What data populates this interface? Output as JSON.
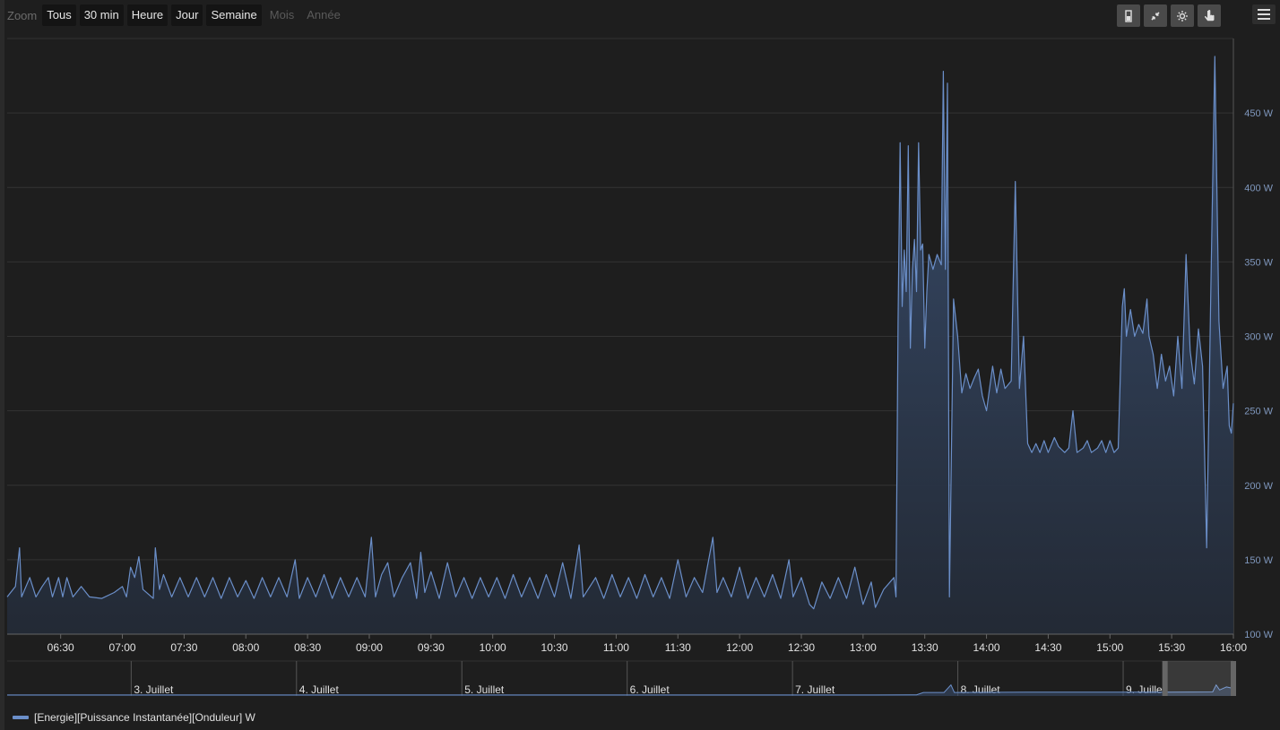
{
  "zoom": {
    "label": "Zoom",
    "buttons": [
      {
        "label": "Tous",
        "enabled": true
      },
      {
        "label": "30 min",
        "enabled": true
      },
      {
        "label": "Heure",
        "enabled": true
      },
      {
        "label": "Jour",
        "enabled": true
      },
      {
        "label": "Semaine",
        "enabled": true
      },
      {
        "label": "Mois",
        "enabled": false
      },
      {
        "label": "Année",
        "enabled": false
      }
    ]
  },
  "toolbar_icons": [
    "column-chart-icon",
    "shrink-arrows-icon",
    "sun-icon",
    "hand-pointer-icon"
  ],
  "menu_icon": "hamburger-menu-icon",
  "colors": {
    "series_line": "#6b8fc9",
    "background": "#1e1e1e",
    "grid": "#333333",
    "axis_label": "#7f97bd"
  },
  "chart_data": {
    "type": "area",
    "title": "",
    "ylim": [
      100,
      500
    ],
    "y_ticks": [
      {
        "value": 100,
        "label": "100 W"
      },
      {
        "value": 150,
        "label": "150 W"
      },
      {
        "value": 200,
        "label": "200 W"
      },
      {
        "value": 250,
        "label": "250 W"
      },
      {
        "value": 300,
        "label": "300 W"
      },
      {
        "value": 350,
        "label": "350 W"
      },
      {
        "value": 400,
        "label": "400 W"
      },
      {
        "value": 450,
        "label": "450 W"
      }
    ],
    "x_range": [
      "06:04",
      "16:00"
    ],
    "x_ticks": [
      "06:30",
      "07:00",
      "07:30",
      "08:00",
      "08:30",
      "09:00",
      "09:30",
      "10:00",
      "10:30",
      "11:00",
      "11:30",
      "12:00",
      "12:30",
      "13:00",
      "13:30",
      "14:00",
      "14:30",
      "15:00",
      "15:30",
      "16:00"
    ],
    "legend_position": "bottom-left",
    "series": [
      {
        "name": "[Energie][Puissance Instantanée][Onduleur] W",
        "x_unit": "time (HH:MM)",
        "points": [
          [
            "06:04",
            125
          ],
          [
            "06:08",
            132
          ],
          [
            "06:10",
            158
          ],
          [
            "06:11",
            125
          ],
          [
            "06:15",
            138
          ],
          [
            "06:18",
            125
          ],
          [
            "06:21",
            132
          ],
          [
            "06:24",
            138
          ],
          [
            "06:26",
            125
          ],
          [
            "06:29",
            138
          ],
          [
            "06:31",
            125
          ],
          [
            "06:33",
            138
          ],
          [
            "06:36",
            125
          ],
          [
            "06:40",
            132
          ],
          [
            "06:44",
            125
          ],
          [
            "06:50",
            124
          ],
          [
            "06:56",
            128
          ],
          [
            "07:00",
            132
          ],
          [
            "07:02",
            125
          ],
          [
            "07:04",
            145
          ],
          [
            "07:06",
            138
          ],
          [
            "07:08",
            152
          ],
          [
            "07:10",
            130
          ],
          [
            "07:15",
            124
          ],
          [
            "07:16",
            158
          ],
          [
            "07:18",
            130
          ],
          [
            "07:20",
            140
          ],
          [
            "07:24",
            125
          ],
          [
            "07:28",
            138
          ],
          [
            "07:32",
            125
          ],
          [
            "07:36",
            138
          ],
          [
            "07:40",
            125
          ],
          [
            "07:44",
            138
          ],
          [
            "07:48",
            124
          ],
          [
            "07:52",
            138
          ],
          [
            "07:56",
            125
          ],
          [
            "08:00",
            136
          ],
          [
            "08:04",
            124
          ],
          [
            "08:08",
            138
          ],
          [
            "08:12",
            125
          ],
          [
            "08:16",
            138
          ],
          [
            "08:20",
            125
          ],
          [
            "08:24",
            150
          ],
          [
            "08:26",
            124
          ],
          [
            "08:30",
            138
          ],
          [
            "08:34",
            125
          ],
          [
            "08:38",
            140
          ],
          [
            "08:42",
            124
          ],
          [
            "08:46",
            138
          ],
          [
            "08:50",
            125
          ],
          [
            "08:54",
            138
          ],
          [
            "08:58",
            125
          ],
          [
            "09:01",
            165
          ],
          [
            "09:03",
            125
          ],
          [
            "09:06",
            140
          ],
          [
            "09:09",
            148
          ],
          [
            "09:12",
            125
          ],
          [
            "09:16",
            138
          ],
          [
            "09:20",
            148
          ],
          [
            "09:23",
            124
          ],
          [
            "09:25",
            155
          ],
          [
            "09:27",
            128
          ],
          [
            "09:30",
            142
          ],
          [
            "09:34",
            124
          ],
          [
            "09:38",
            148
          ],
          [
            "09:42",
            125
          ],
          [
            "09:46",
            138
          ],
          [
            "09:50",
            124
          ],
          [
            "09:54",
            138
          ],
          [
            "09:58",
            125
          ],
          [
            "10:02",
            138
          ],
          [
            "10:06",
            124
          ],
          [
            "10:10",
            140
          ],
          [
            "10:14",
            125
          ],
          [
            "10:18",
            138
          ],
          [
            "10:22",
            124
          ],
          [
            "10:26",
            140
          ],
          [
            "10:30",
            125
          ],
          [
            "10:34",
            148
          ],
          [
            "10:38",
            124
          ],
          [
            "10:42",
            160
          ],
          [
            "10:44",
            125
          ],
          [
            "10:50",
            138
          ],
          [
            "10:54",
            124
          ],
          [
            "10:58",
            140
          ],
          [
            "11:02",
            125
          ],
          [
            "11:06",
            138
          ],
          [
            "11:10",
            124
          ],
          [
            "11:14",
            140
          ],
          [
            "11:18",
            125
          ],
          [
            "11:22",
            138
          ],
          [
            "11:26",
            124
          ],
          [
            "11:30",
            150
          ],
          [
            "11:34",
            125
          ],
          [
            "11:38",
            138
          ],
          [
            "11:42",
            128
          ],
          [
            "11:47",
            165
          ],
          [
            "11:49",
            128
          ],
          [
            "11:52",
            138
          ],
          [
            "11:56",
            125
          ],
          [
            "12:00",
            145
          ],
          [
            "12:04",
            124
          ],
          [
            "12:08",
            138
          ],
          [
            "12:12",
            125
          ],
          [
            "12:16",
            140
          ],
          [
            "12:20",
            124
          ],
          [
            "12:24",
            150
          ],
          [
            "12:26",
            125
          ],
          [
            "12:30",
            138
          ],
          [
            "12:34",
            120
          ],
          [
            "12:36",
            117
          ],
          [
            "12:40",
            135
          ],
          [
            "12:44",
            124
          ],
          [
            "12:48",
            138
          ],
          [
            "12:52",
            124
          ],
          [
            "12:56",
            145
          ],
          [
            "13:00",
            120
          ],
          [
            "13:04",
            135
          ],
          [
            "13:06",
            118
          ],
          [
            "13:10",
            130
          ],
          [
            "13:15",
            138
          ],
          [
            "13:16",
            125
          ],
          [
            "13:17",
            310
          ],
          [
            "13:18",
            430
          ],
          [
            "13:19",
            320
          ],
          [
            "13:20",
            358
          ],
          [
            "13:21",
            330
          ],
          [
            "13:22",
            428
          ],
          [
            "13:23",
            292
          ],
          [
            "13:24",
            345
          ],
          [
            "13:25",
            365
          ],
          [
            "13:26",
            330
          ],
          [
            "13:27",
            430
          ],
          [
            "13:28",
            358
          ],
          [
            "13:29",
            362
          ],
          [
            "13:30",
            292
          ],
          [
            "13:31",
            330
          ],
          [
            "13:32",
            355
          ],
          [
            "13:34",
            345
          ],
          [
            "13:36",
            355
          ],
          [
            "13:38",
            348
          ],
          [
            "13:39",
            478
          ],
          [
            "13:40",
            345
          ],
          [
            "13:41",
            470
          ],
          [
            "13:42",
            125
          ],
          [
            "13:44",
            325
          ],
          [
            "13:46",
            300
          ],
          [
            "13:48",
            262
          ],
          [
            "13:50",
            275
          ],
          [
            "13:52",
            265
          ],
          [
            "13:54",
            272
          ],
          [
            "13:56",
            278
          ],
          [
            "13:58",
            260
          ],
          [
            "14:00",
            250
          ],
          [
            "14:03",
            280
          ],
          [
            "14:05",
            262
          ],
          [
            "14:07",
            278
          ],
          [
            "14:09",
            265
          ],
          [
            "14:12",
            270
          ],
          [
            "14:14",
            404
          ],
          [
            "14:16",
            265
          ],
          [
            "14:18",
            300
          ],
          [
            "14:20",
            228
          ],
          [
            "14:22",
            222
          ],
          [
            "14:24",
            228
          ],
          [
            "14:26",
            222
          ],
          [
            "14:28",
            230
          ],
          [
            "14:30",
            222
          ],
          [
            "14:33",
            232
          ],
          [
            "14:35",
            226
          ],
          [
            "14:38",
            222
          ],
          [
            "14:40",
            225
          ],
          [
            "14:42",
            250
          ],
          [
            "14:44",
            222
          ],
          [
            "14:47",
            225
          ],
          [
            "14:49",
            230
          ],
          [
            "14:51",
            222
          ],
          [
            "14:54",
            225
          ],
          [
            "14:56",
            230
          ],
          [
            "14:58",
            222
          ],
          [
            "15:00",
            230
          ],
          [
            "15:02",
            222
          ],
          [
            "15:04",
            225
          ],
          [
            "15:06",
            320
          ],
          [
            "15:07",
            332
          ],
          [
            "15:08",
            300
          ],
          [
            "15:10",
            318
          ],
          [
            "15:12",
            300
          ],
          [
            "15:14",
            308
          ],
          [
            "15:16",
            302
          ],
          [
            "15:18",
            325
          ],
          [
            "15:19",
            300
          ],
          [
            "15:21",
            288
          ],
          [
            "15:23",
            265
          ],
          [
            "15:25",
            288
          ],
          [
            "15:27",
            270
          ],
          [
            "15:29",
            280
          ],
          [
            "15:31",
            260
          ],
          [
            "15:33",
            300
          ],
          [
            "15:35",
            265
          ],
          [
            "15:37",
            355
          ],
          [
            "15:39",
            290
          ],
          [
            "15:41",
            268
          ],
          [
            "15:43",
            305
          ],
          [
            "15:45",
            280
          ],
          [
            "15:47",
            158
          ],
          [
            "15:49",
            330
          ],
          [
            "15:51",
            488
          ],
          [
            "15:53",
            310
          ],
          [
            "15:55",
            265
          ],
          [
            "15:57",
            280
          ],
          [
            "15:58",
            240
          ],
          [
            "15:59",
            235
          ],
          [
            "16:00",
            255
          ]
        ]
      }
    ]
  },
  "navigator": {
    "labels": [
      "3. Juillet",
      "4. Juillet",
      "5. Juillet",
      "6. Juillet",
      "7. Juillet",
      "8. Juillet",
      "9. Juillet"
    ],
    "x_range": [
      "02.07 06:00",
      "09.07 16:00"
    ],
    "selected_range": [
      "09.07 06:04",
      "09.07 16:00"
    ],
    "points": [
      [
        "02.07 06:00",
        10
      ],
      [
        "04.07 12:00",
        10
      ],
      [
        "07.07 12:00",
        10
      ],
      [
        "07.07 18:00",
        12
      ],
      [
        "07.07 19:00",
        35
      ],
      [
        "07.07 22:00",
        35
      ],
      [
        "07.07 23:00",
        110
      ],
      [
        "07.07 23:30",
        35
      ],
      [
        "08.07 12:00",
        38
      ],
      [
        "09.07 06:00",
        38
      ],
      [
        "09.07 13:00",
        40
      ],
      [
        "09.07 13:30",
        110
      ],
      [
        "09.07 14:00",
        60
      ],
      [
        "09.07 15:00",
        90
      ],
      [
        "09.07 16:00",
        75
      ]
    ]
  },
  "legend": {
    "label": "[Energie][Puissance Instantanée][Onduleur] W"
  }
}
